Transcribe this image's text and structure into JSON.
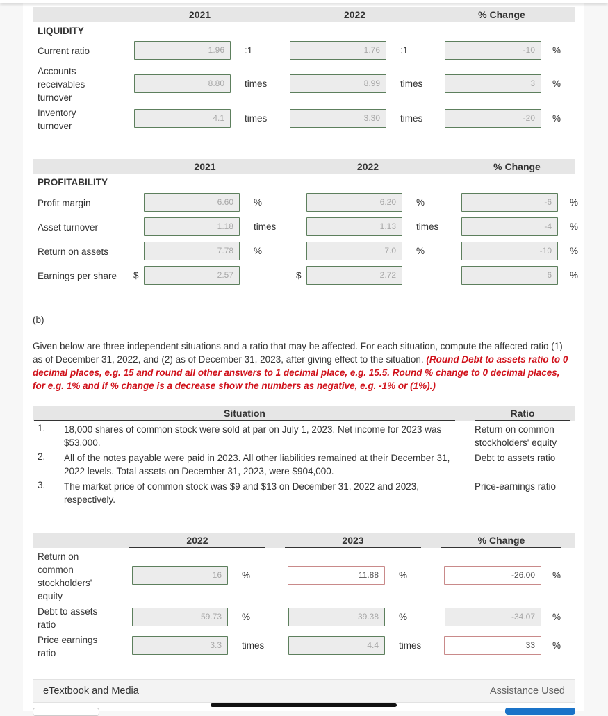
{
  "liquidity": {
    "section_label": "LIQUIDITY",
    "columns": [
      "2021",
      "2022",
      "% Change"
    ],
    "rows": [
      {
        "label": "Current ratio",
        "v2021": "1.96",
        "u2021": ":1",
        "v2022": "1.76",
        "u2022": ":1",
        "change": "-10",
        "uchange": "%"
      },
      {
        "label": "Accounts receivables turnover",
        "v2021": "8.80",
        "u2021": "times",
        "v2022": "8.99",
        "u2022": "times",
        "change": "3",
        "uchange": "%"
      },
      {
        "label": "Inventory turnover",
        "v2021": "4.1",
        "u2021": "times",
        "v2022": "3.30",
        "u2022": "times",
        "change": "-20",
        "uchange": "%"
      }
    ]
  },
  "profitability": {
    "section_label": "PROFITABILITY",
    "columns": [
      "2021",
      "2022",
      "% Change"
    ],
    "rows": [
      {
        "label": "Profit margin",
        "prefix": "",
        "v2021": "6.60",
        "u2021": "%",
        "v2022": "6.20",
        "u2022": "%",
        "change": "-6",
        "uchange": "%"
      },
      {
        "label": "Asset turnover",
        "prefix": "",
        "v2021": "1.18",
        "u2021": "times",
        "v2022": "1.13",
        "u2022": "times",
        "change": "-4",
        "uchange": "%"
      },
      {
        "label": "Return on assets",
        "prefix": "",
        "v2021": "7.78",
        "u2021": "%",
        "v2022": "7.0",
        "u2022": "%",
        "change": "-10",
        "uchange": "%"
      },
      {
        "label": "Earnings per share",
        "prefix": "$",
        "v2021": "2.57",
        "u2021": "",
        "v2022": "2.72",
        "u2022": "",
        "change": "6",
        "uchange": "%"
      }
    ]
  },
  "part_b": {
    "label": "(b)",
    "instructions": "Given below are three independent situations and a ratio that may be affected. For each situation, compute the affected ratio (1) as of December 31, 2022, and (2) as of December 31, 2023, after giving effect to the situation.",
    "instructions_red": "(Round Debt to assets ratio to 0 decimal places, e.g. 15 and round all other answers to 1 decimal place, e.g. 15.5. Round % change to 0 decimal places, for e.g. 1% and if % change is a decrease show the numbers as negative, e.g. -1% or (1%).)",
    "situation_header": "Situation",
    "ratio_header": "Ratio",
    "situations": [
      {
        "num": "1.",
        "text": "18,000 shares of common stock were sold at par on July 1, 2023. Net income for 2023 was $53,000.",
        "ratio": "Return on common stockholders' equity"
      },
      {
        "num": "2.",
        "text": "All of the notes payable were paid in 2023. All other liabilities remained at their December 31, 2022 levels. Total assets on December 31, 2023, were $904,000.",
        "ratio": "Debt to assets ratio"
      },
      {
        "num": "3.",
        "text": "The market price of common stock was $9 and $13 on December 31, 2022 and 2023, respectively.",
        "ratio": "Price-earnings ratio"
      }
    ]
  },
  "answers": {
    "columns": [
      "2022",
      "2023",
      "% Change"
    ],
    "rows": [
      {
        "label": "Return on common stockholders' equity",
        "v2022": "16",
        "u2022": "%",
        "v2023": "11.88",
        "u2023": "%",
        "change": "-26.00",
        "uchange": "%"
      },
      {
        "label": "Debt to assets ratio",
        "v2022": "59.73",
        "u2022": "%",
        "v2023": "39.38",
        "u2023": "%",
        "change": "-34.07",
        "uchange": "%"
      },
      {
        "label": "Price earnings ratio",
        "v2022": "3.3",
        "u2022": "times",
        "v2023": "4.4",
        "u2023": "times",
        "change": "33",
        "uchange": "%"
      }
    ]
  },
  "footer": {
    "left": "eTextbook and Media",
    "right": "Assistance Used"
  }
}
